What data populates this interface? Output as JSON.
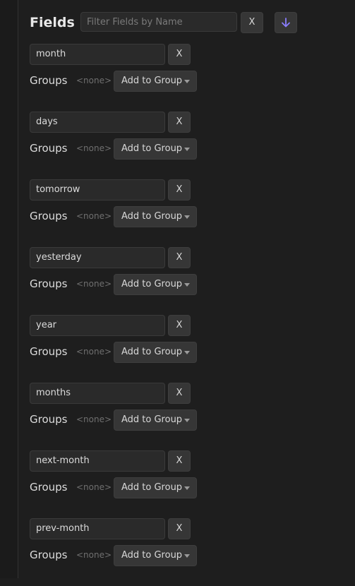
{
  "header": {
    "title": "Fields",
    "filter_placeholder": "Filter Fields by Name",
    "clear_label": "X",
    "sort_icon": "arrow-down-icon",
    "accent_color": "#8a7dff"
  },
  "groups_label": "Groups",
  "none_label": "<none>",
  "add_to_group_label": "Add to Group",
  "remove_label": "X",
  "fields": [
    {
      "name": "month"
    },
    {
      "name": "days"
    },
    {
      "name": "tomorrow"
    },
    {
      "name": "yesterday"
    },
    {
      "name": "year"
    },
    {
      "name": "months"
    },
    {
      "name": "next-month"
    },
    {
      "name": "prev-month"
    }
  ]
}
